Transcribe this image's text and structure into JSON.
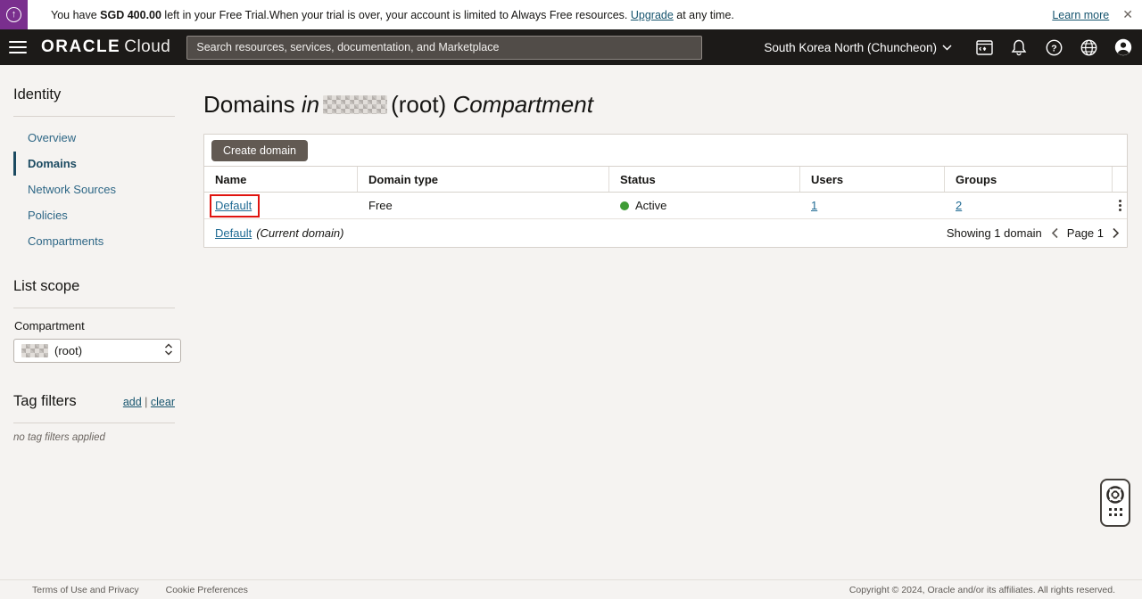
{
  "colors": {
    "banner_accent": "#7a2f8e",
    "topbar_bg": "#1c1a18",
    "link": "#1f6a93",
    "sidebar_link": "#2e6786",
    "active_nav": "#1b4a61",
    "status_active_green": "#3f9c36",
    "annotation_red": "#e0140f",
    "button_bg": "#625a53",
    "body_bg": "#f5f3f1"
  },
  "icons": [
    "upgrade-arrow-icon",
    "close-icon",
    "hamburger-icon",
    "chevron-down-icon",
    "cloud-shell-icon",
    "bell-icon",
    "help-icon",
    "globe-icon",
    "avatar-icon",
    "stepper-icon",
    "kebab-menu-icon",
    "chevron-left-icon",
    "chevron-right-icon",
    "life-ring-icon",
    "dots-grid-icon"
  ],
  "trial_banner": {
    "prefix": "You have ",
    "amount": "SGD 400.00",
    "middle": " left in your Free Trial.When your trial is over, your account is limited to Always Free resources. ",
    "upgrade_link": "Upgrade",
    "suffix": " at any time.",
    "learn_more": "Learn more"
  },
  "header": {
    "logo_oracle": "ORACLE",
    "logo_cloud": "Cloud",
    "search_placeholder": "Search resources, services, documentation, and Marketplace",
    "region": "South Korea North (Chuncheon)"
  },
  "sidebar": {
    "title": "Identity",
    "items": [
      {
        "label": "Overview",
        "active": false
      },
      {
        "label": "Domains",
        "active": true
      },
      {
        "label": "Network Sources",
        "active": false
      },
      {
        "label": "Policies",
        "active": false
      },
      {
        "label": "Compartments",
        "active": false
      }
    ],
    "list_scope": {
      "title": "List scope",
      "compartment_label": "Compartment",
      "selected_suffix": "(root)"
    },
    "tag_filters": {
      "title": "Tag filters",
      "add_link": "add",
      "separator": "|",
      "clear_link": "clear",
      "empty_text": "no tag filters applied"
    }
  },
  "main": {
    "title": {
      "part1": "Domains",
      "part2": "in",
      "part3": "(root)",
      "part4": "Compartment"
    },
    "toolbar": {
      "create_button": "Create domain"
    },
    "table": {
      "columns": [
        "Name",
        "Domain type",
        "Status",
        "Users",
        "Groups"
      ],
      "rows": [
        {
          "name": "Default",
          "domain_type": "Free",
          "status": "Active",
          "users": "1",
          "groups": "2"
        }
      ],
      "footer": {
        "current_domain_link": "Default",
        "current_domain_note": "(Current domain)",
        "showing_text": "Showing 1 domain",
        "page_label": "Page 1"
      }
    }
  },
  "page_footer": {
    "terms_link": "Terms of Use and Privacy",
    "cookie_link": "Cookie Preferences",
    "copyright": "Copyright © 2024, Oracle and/or its affiliates. All rights reserved."
  }
}
